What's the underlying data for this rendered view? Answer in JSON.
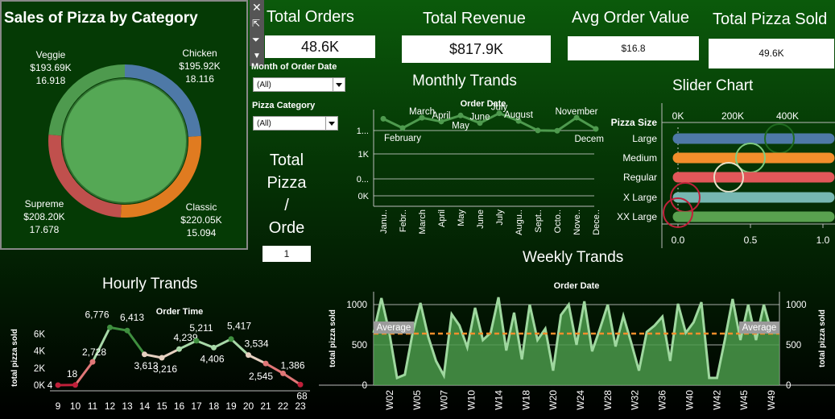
{
  "category": {
    "title": "Sales of Pizza by Category",
    "labels": [
      {
        "name": "Veggie",
        "value": "$193.69K",
        "pct": "16.918"
      },
      {
        "name": "Chicken",
        "value": "$195.92K",
        "pct": "18.116"
      },
      {
        "name": "Supreme",
        "value": "$208.20K",
        "pct": "17.678"
      },
      {
        "name": "Classic",
        "value": "$220.05K",
        "pct": "15.094"
      }
    ]
  },
  "kpis": {
    "total_orders": {
      "title": "Total Orders",
      "value": "48.6K"
    },
    "total_revenue": {
      "title": "Total Revenue",
      "value": "$817.9K"
    },
    "avg_order_value": {
      "title": "Avg Order Value",
      "value": "$16.8"
    },
    "total_pizza_sold": {
      "title": "Total Pizza Sold",
      "value": "49.6K"
    }
  },
  "filters": {
    "month_label": "Month of Order Date",
    "month_value": "(All)",
    "category_label": "Pizza Category",
    "category_value": "(All)"
  },
  "ppo": {
    "title_lines": [
      "Total",
      "Pizza",
      "/",
      "Orde"
    ],
    "value": "1"
  },
  "monthly": {
    "title": "Monthly Trands",
    "header": "Order Date"
  },
  "slider": {
    "title": "Slider Chart",
    "row_header": "Pizza Size"
  },
  "weekly": {
    "title": "Weekly Trands",
    "header": "Order Date",
    "ylabel": "total pizza sold",
    "ref_label": "Average"
  },
  "hourly": {
    "title": "Hourly Trands",
    "header": "Order Time",
    "ylabel": "total pizza sold"
  },
  "colors": {
    "green_line": "#4e9a4e",
    "orange": "#f28e2b",
    "blue": "#4e79a7",
    "red": "#e15759",
    "teal": "#76b7b2",
    "gold": "#d6a21c"
  },
  "chart_data": [
    {
      "type": "pie",
      "name": "category-donut",
      "categories": [
        "Veggie",
        "Chicken",
        "Classic",
        "Supreme"
      ],
      "values": [
        193.69,
        195.92,
        220.05,
        208.2
      ],
      "colors": [
        "#4e9a4e",
        "#4e79a7",
        "#e07b20",
        "#c0504d"
      ]
    },
    {
      "type": "line",
      "name": "monthly",
      "categories": [
        "January",
        "February",
        "March",
        "April",
        "May",
        "June",
        "July",
        "August",
        "September",
        "October",
        "November",
        "December"
      ],
      "tick_labels": [
        "Janu..",
        "Febr..",
        "March",
        "April",
        "May",
        "June",
        "July",
        "Augu..",
        "Sept..",
        "Octo..",
        "Nove..",
        "Dece.."
      ],
      "point_labels": [
        "",
        "February",
        "March",
        "April",
        "May",
        "June",
        "July",
        "August",
        "",
        "",
        "November",
        "December"
      ],
      "values": [
        4232,
        3961,
        4261,
        4151,
        4328,
        4107,
        4392,
        4168,
        3890,
        3883,
        4266,
        3935
      ],
      "y_tick_labels": [
        "1...",
        "1K",
        "0...",
        "0K"
      ]
    },
    {
      "type": "bar",
      "name": "slider",
      "categories": [
        "Large",
        "Medium",
        "Regular",
        "X Large",
        "XX Large"
      ],
      "values": [
        0.7,
        0.5,
        0.35,
        0.05,
        0.0
      ],
      "x_tick_top": [
        "0K",
        "200K",
        "400K"
      ],
      "x_tick_bottom": [
        "0.0",
        "0.5",
        "1.0"
      ],
      "colors": [
        "#4e79a7",
        "#f28e2b",
        "#e15759",
        "#76b7b2",
        "#59a14f"
      ]
    },
    {
      "type": "area",
      "name": "weekly",
      "x": [
        1,
        2,
        3,
        4,
        5,
        6,
        7,
        8,
        9,
        10,
        11,
        12,
        13,
        14,
        15,
        16,
        17,
        18,
        19,
        20,
        21,
        22,
        23,
        24,
        25,
        26,
        27,
        28,
        29,
        30,
        31,
        32,
        33,
        34,
        35,
        36,
        37,
        38,
        39,
        40,
        41,
        42,
        43,
        44,
        45,
        46,
        47,
        48,
        49,
        50,
        51,
        52,
        53
      ],
      "tick_labels": [
        "W02",
        "W05",
        "W07",
        "W10",
        "W14",
        "W18",
        "W20",
        "W24",
        "W28",
        "W32",
        "W36",
        "W40",
        "W42",
        "W45",
        "W49"
      ],
      "values": [
        650,
        1080,
        660,
        90,
        130,
        650,
        1020,
        600,
        300,
        120,
        880,
        740,
        470,
        960,
        560,
        650,
        1090,
        430,
        900,
        320,
        1000,
        560,
        700,
        180,
        870,
        1000,
        500,
        1040,
        420,
        700,
        1000,
        480,
        860,
        530,
        180,
        660,
        740,
        850,
        300,
        1010,
        650,
        780,
        1030,
        90,
        90,
        560,
        1070,
        560,
        1000,
        560,
        1000,
        650,
        650
      ],
      "ylim": [
        0,
        1100
      ],
      "y_ticks": [
        0,
        500,
        1000
      ],
      "reference_line": {
        "label": "Average",
        "value": 640
      }
    },
    {
      "type": "line",
      "name": "hourly",
      "categories": [
        "9",
        "10",
        "11",
        "12",
        "13",
        "14",
        "15",
        "16",
        "17",
        "18",
        "19",
        "20",
        "21",
        "22",
        "23"
      ],
      "values": [
        4,
        18,
        2728,
        6776,
        6413,
        3613,
        3216,
        4239,
        5211,
        4406,
        5417,
        3534,
        2545,
        1386,
        68
      ],
      "labels": [
        "4",
        "18",
        "2,728",
        "6,776",
        "6,413",
        "3,613",
        "3,216",
        "4,239",
        "5,211",
        "4,406",
        "5,417",
        "3,534",
        "2,545",
        "1,386",
        "68"
      ],
      "y_tick_labels": [
        "0K",
        "2K",
        "4K",
        "6K"
      ],
      "ylim": [
        0,
        7000
      ]
    }
  ]
}
